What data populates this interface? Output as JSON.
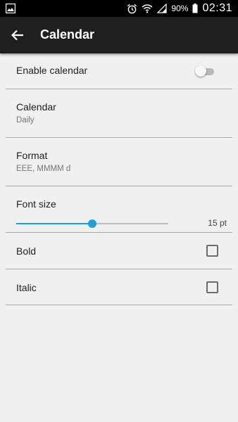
{
  "status_bar": {
    "battery_text": "90%",
    "time": "02:31",
    "icons": [
      "image-icon",
      "alarm-icon",
      "wifi-icon",
      "signal-icon",
      "battery-icon"
    ]
  },
  "app_bar": {
    "title": "Calendar",
    "back_icon": "arrow-left-icon"
  },
  "settings": {
    "enable_calendar": {
      "label": "Enable calendar",
      "checked": false
    },
    "calendar": {
      "label": "Calendar",
      "value": "Daily"
    },
    "format": {
      "label": "Format",
      "value": "EEE, MMMM d"
    },
    "font_size": {
      "label": "Font size",
      "value_text": "15 pt",
      "fraction": 0.5
    },
    "bold": {
      "label": "Bold",
      "checked": false
    },
    "italic": {
      "label": "Italic",
      "checked": false
    }
  },
  "colors": {
    "accent": "#1e9fd6",
    "app_bar": "#1f1f1f",
    "background": "#f0f0f0"
  }
}
